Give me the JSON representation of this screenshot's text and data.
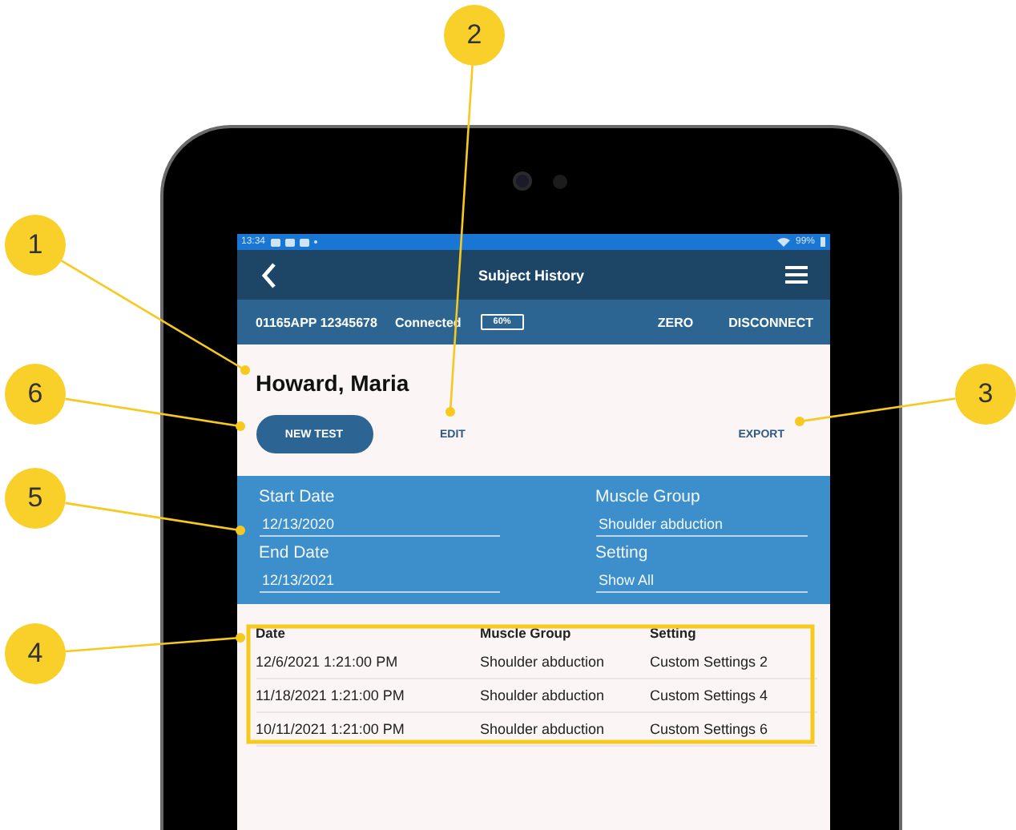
{
  "annotations": [
    {
      "number": "2"
    },
    {
      "number": "1"
    },
    {
      "number": "6"
    },
    {
      "number": "3"
    },
    {
      "number": "5"
    },
    {
      "number": "4"
    }
  ],
  "status_bar": {
    "time": "13:34",
    "battery": "99%"
  },
  "app_bar": {
    "title": "Subject History"
  },
  "device_bar": {
    "device_id": "01165APP 12345678",
    "connection": "Connected",
    "battery_reading": "60%",
    "actions": [
      "ZERO",
      "DISCONNECT"
    ]
  },
  "subject": {
    "name": "Howard, Maria"
  },
  "actions": [
    {
      "label": "NEW TEST",
      "kind": "primary"
    },
    {
      "label": "EDIT",
      "kind": "text"
    },
    {
      "label": "EXPORT",
      "kind": "text"
    }
  ],
  "filters": [
    {
      "label": "Start Date",
      "value": "12/13/2020"
    },
    {
      "label": "Muscle Group",
      "value": "Shoulder abduction"
    },
    {
      "label": "End Date",
      "value": "12/13/2021"
    },
    {
      "label": "Setting",
      "value": "Show All"
    }
  ],
  "table": {
    "columns": [
      "Date",
      "Muscle Group",
      "Setting"
    ],
    "rows": [
      [
        "12/6/2021 1:21:00 PM",
        "Shoulder abduction",
        "Custom Settings 2"
      ],
      [
        "11/18/2021 1:21:00 PM",
        "Shoulder abduction",
        "Custom Settings 4"
      ],
      [
        "10/11/2021 1:21:00 PM",
        "Shoulder abduction",
        "Custom Settings 6"
      ]
    ]
  }
}
